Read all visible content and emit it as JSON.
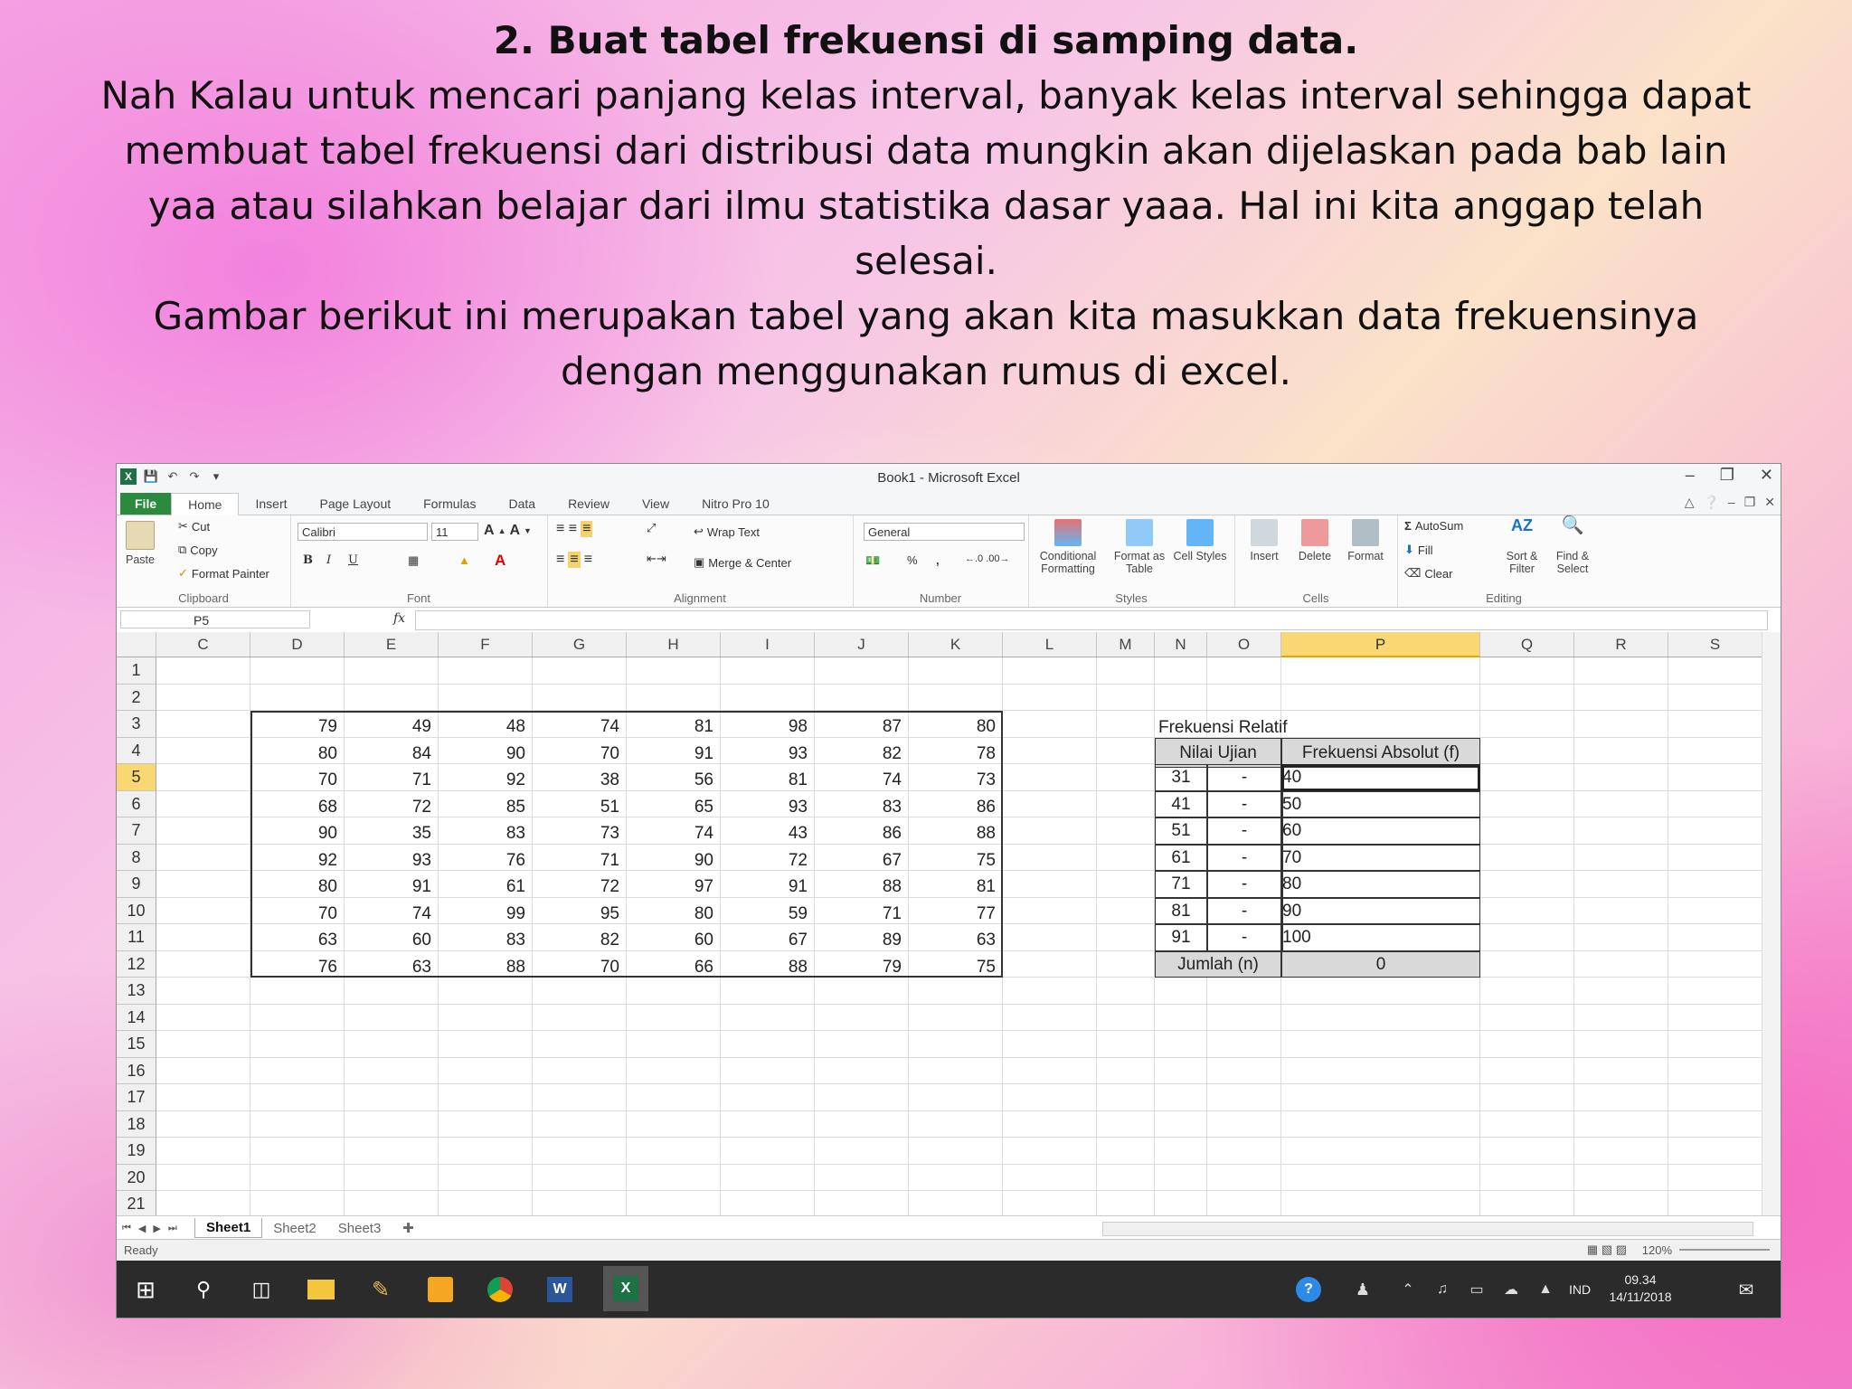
{
  "slide": {
    "title": "2.  Buat tabel frekuensi di samping data.",
    "lines": [
      "Nah Kalau untuk mencari panjang kelas interval, banyak kelas interval sehingga dapat",
      "membuat tabel frekuensi dari distribusi data mungkin akan dijelaskan pada bab lain",
      "yaa atau silahkan belajar dari ilmu statistika dasar yaaa. Hal ini kita anggap telah",
      "selesai.",
      "Gambar berikut ini merupakan tabel yang akan kita masukkan data frekuensinya",
      "dengan menggunakan rumus di excel."
    ]
  },
  "excel": {
    "window_title": "Book1 - Microsoft Excel",
    "tabs": [
      "File",
      "Home",
      "Insert",
      "Page Layout",
      "Formulas",
      "Data",
      "Review",
      "View",
      "Nitro Pro 10"
    ],
    "ribbon": {
      "clipboard": {
        "paste": "Paste",
        "cut": "Cut",
        "copy": "Copy",
        "format_painter": "Format Painter",
        "label": "Clipboard"
      },
      "font": {
        "name": "Calibri",
        "size": "11",
        "label": "Font",
        "bold": "B",
        "italic": "I",
        "underline": "U"
      },
      "alignment": {
        "wrap_text": "Wrap Text",
        "merge_center": "Merge & Center",
        "label": "Alignment"
      },
      "number": {
        "format": "General",
        "percent": "%",
        "comma": ",",
        "label": "Number"
      },
      "styles": {
        "conditional": "Conditional Formatting",
        "format_table": "Format as Table",
        "cell_styles": "Cell Styles",
        "label": "Styles"
      },
      "cells": {
        "insert": "Insert",
        "delete": "Delete",
        "format": "Format",
        "label": "Cells"
      },
      "editing": {
        "autosum": "AutoSum",
        "fill": "Fill",
        "clear": "Clear",
        "sort": "Sort & Filter",
        "find": "Find & Select",
        "label": "Editing"
      }
    },
    "name_box": "P5",
    "fx": "fx",
    "columns": [
      "C",
      "D",
      "E",
      "F",
      "G",
      "H",
      "I",
      "J",
      "K",
      "L",
      "M",
      "N",
      "O",
      "P",
      "Q",
      "R",
      "S"
    ],
    "rows": [
      "1",
      "2",
      "3",
      "4",
      "5",
      "6",
      "7",
      "8",
      "9",
      "10",
      "11",
      "12",
      "13",
      "14",
      "15",
      "16",
      "17",
      "18",
      "19",
      "20",
      "21"
    ],
    "data_table": [
      [
        "79",
        "49",
        "48",
        "74",
        "81",
        "98",
        "87",
        "80"
      ],
      [
        "80",
        "84",
        "90",
        "70",
        "91",
        "93",
        "82",
        "78"
      ],
      [
        "70",
        "71",
        "92",
        "38",
        "56",
        "81",
        "74",
        "73"
      ],
      [
        "68",
        "72",
        "85",
        "51",
        "65",
        "93",
        "83",
        "86"
      ],
      [
        "90",
        "35",
        "83",
        "73",
        "74",
        "43",
        "86",
        "88"
      ],
      [
        "92",
        "93",
        "76",
        "71",
        "90",
        "72",
        "67",
        "75"
      ],
      [
        "80",
        "91",
        "61",
        "72",
        "97",
        "91",
        "88",
        "81"
      ],
      [
        "70",
        "74",
        "99",
        "95",
        "80",
        "59",
        "71",
        "77"
      ],
      [
        "63",
        "60",
        "83",
        "82",
        "60",
        "67",
        "89",
        "63"
      ],
      [
        "76",
        "63",
        "88",
        "70",
        "66",
        "88",
        "79",
        "75"
      ]
    ],
    "freq_table": {
      "caption": "Frekuensi Relatif",
      "header_interval": "Nilai Ujian",
      "header_freq": "Frekuensi Absolut (f)",
      "intervals": [
        {
          "low": "31",
          "dash": "-",
          "high": "40"
        },
        {
          "low": "41",
          "dash": "-",
          "high": "50"
        },
        {
          "low": "51",
          "dash": "-",
          "high": "60"
        },
        {
          "low": "61",
          "dash": "-",
          "high": "70"
        },
        {
          "low": "71",
          "dash": "-",
          "high": "80"
        },
        {
          "low": "81",
          "dash": "-",
          "high": "90"
        },
        {
          "low": "91",
          "dash": "-",
          "high": "100"
        }
      ],
      "total_label": "Jumlah (n)",
      "total_value": "0"
    },
    "sheets": [
      "Sheet1",
      "Sheet2",
      "Sheet3"
    ],
    "status": "Ready",
    "zoom": "120%",
    "taskbar": {
      "lang": "IND",
      "time": "09.34",
      "date": "14/11/2018"
    }
  }
}
